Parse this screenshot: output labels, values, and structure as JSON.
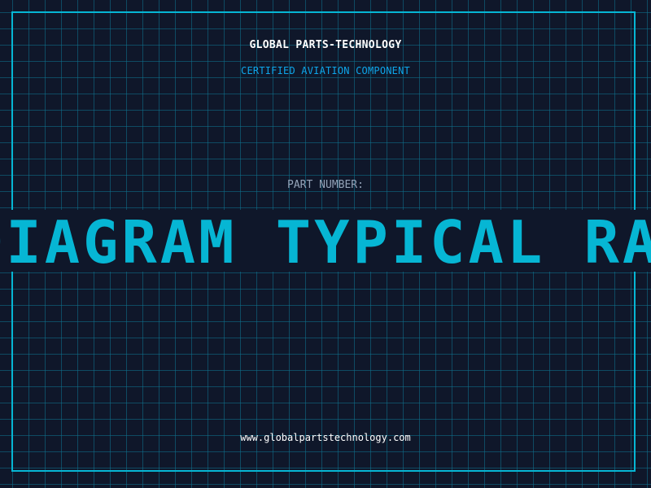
{
  "header": {
    "company": "GLOBAL PARTS-TECHNOLOGY",
    "subtitle": "CERTIFIED AVIATION COMPONENT"
  },
  "part": {
    "label": "PART NUMBER:",
    "value": "DIAGRAM TYPICAL RADAR"
  },
  "footer": {
    "website": "www.globalpartstechnology.com"
  },
  "colors": {
    "background": "#0f172a",
    "accent": "#06b6d4",
    "grid": "#0e7490"
  }
}
